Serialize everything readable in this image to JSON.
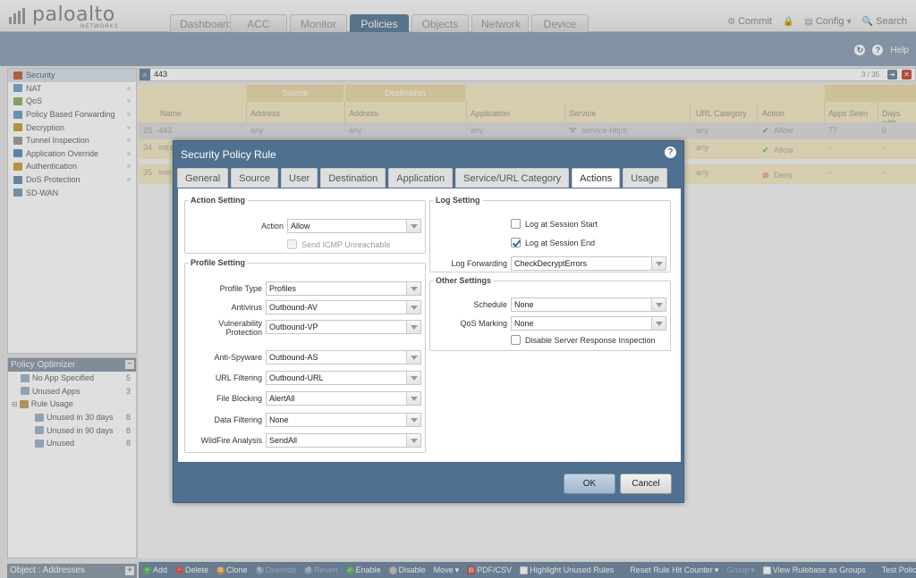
{
  "header": {
    "brand": "paloalto",
    "brand_sub": "NETWORKS",
    "tabs": [
      "Dashboard",
      "ACC",
      "Monitor",
      "Policies",
      "Objects",
      "Network",
      "Device"
    ],
    "active_tab": "Policies",
    "actions": {
      "commit": "Commit",
      "config": "Config",
      "search": "Search"
    },
    "help": "Help"
  },
  "sidebar": {
    "items": [
      "Security",
      "NAT",
      "QoS",
      "Policy Based Forwarding",
      "Decryption",
      "Tunnel Inspection",
      "Application Override",
      "Authentication",
      "DoS Protection",
      "SD-WAN"
    ],
    "selected": "Security"
  },
  "optimizer": {
    "title": "Policy Optimizer",
    "items": [
      {
        "label": "No App Specified",
        "count": "5"
      },
      {
        "label": "Unused Apps",
        "count": "3"
      },
      {
        "label": "Rule Usage",
        "count": ""
      },
      {
        "label": "Unused in 30 days",
        "count": "8"
      },
      {
        "label": "Unused in 90 days",
        "count": "8"
      },
      {
        "label": "Unused",
        "count": "8"
      }
    ]
  },
  "object_panel": {
    "title": "Object : Addresses"
  },
  "filter": {
    "value": "443",
    "page": "3 / 35"
  },
  "grid": {
    "groups": {
      "source": "Source",
      "destination": "Destination"
    },
    "columns": [
      "Name",
      "Address",
      "Address",
      "Application",
      "Service",
      "URL Category",
      "Action",
      "Apps Seen",
      "Days with"
    ],
    "rows": [
      {
        "num": "23",
        "name": "443",
        "src": "any",
        "dst": "any",
        "app": "any",
        "svc": "service-https",
        "url": "any",
        "action": "Allow",
        "apps": "77",
        "days": "0"
      },
      {
        "num": "34",
        "name": "intra",
        "src": "",
        "dst": "",
        "app": "",
        "svc": "",
        "url": "any",
        "action": "Allow",
        "apps": "-",
        "days": "-"
      },
      {
        "num": "35",
        "name": "inte",
        "src": "",
        "dst": "",
        "app": "",
        "svc": "",
        "url": "any",
        "action": "Deny",
        "apps": "-",
        "days": "-"
      }
    ]
  },
  "toolbar": {
    "add": "Add",
    "delete": "Delete",
    "clone": "Clone",
    "override": "Override",
    "revert": "Revert",
    "enable": "Enable",
    "disable": "Disable",
    "move": "Move",
    "pdf": "PDF/CSV",
    "highlight": "Highlight Unused Rules",
    "reset": "Reset Rule Hit Counter",
    "group": "Group",
    "view_groups": "View Rulebase as Groups",
    "test": "Test Policy Match"
  },
  "dialog": {
    "title": "Security Policy Rule",
    "tabs": [
      "General",
      "Source",
      "User",
      "Destination",
      "Application",
      "Service/URL Category",
      "Actions",
      "Usage"
    ],
    "active_tab": "Actions",
    "action_setting": {
      "legend": "Action Setting",
      "action_label": "Action",
      "action_value": "Allow",
      "icmp_label": "Send ICMP Unreachable",
      "icmp_checked": false
    },
    "profile_setting": {
      "legend": "Profile Setting",
      "fields": [
        {
          "label": "Profile Type",
          "value": "Profiles"
        },
        {
          "label": "Antivirus",
          "value": "Outbound-AV"
        },
        {
          "label": "Vulnerability Protection",
          "value": "Outbound-VP"
        },
        {
          "label": "Anti-Spyware",
          "value": "Outbound-AS"
        },
        {
          "label": "URL Filtering",
          "value": "Outbound-URL"
        },
        {
          "label": "File Blocking",
          "value": "AlertAll"
        },
        {
          "label": "Data Filtering",
          "value": "None"
        },
        {
          "label": "WildFire Analysis",
          "value": "SendAll"
        }
      ]
    },
    "log_setting": {
      "legend": "Log Setting",
      "start_label": "Log at Session Start",
      "start_checked": false,
      "end_label": "Log at Session End",
      "end_checked": true,
      "forwarding_label": "Log Forwarding",
      "forwarding_value": "CheckDecryptErrors"
    },
    "other_settings": {
      "legend": "Other Settings",
      "schedule_label": "Schedule",
      "schedule_value": "None",
      "qos_label": "QoS Marking",
      "qos_value": "None",
      "dsri_label": "Disable Server Response Inspection",
      "dsri_checked": false
    },
    "ok": "OK",
    "cancel": "Cancel"
  },
  "colors": {
    "accent": "#4f708e",
    "band": "#8fa3b6",
    "header_row": "#f5e9c5",
    "allow": "#5cb85c",
    "deny": "#d9534f"
  }
}
